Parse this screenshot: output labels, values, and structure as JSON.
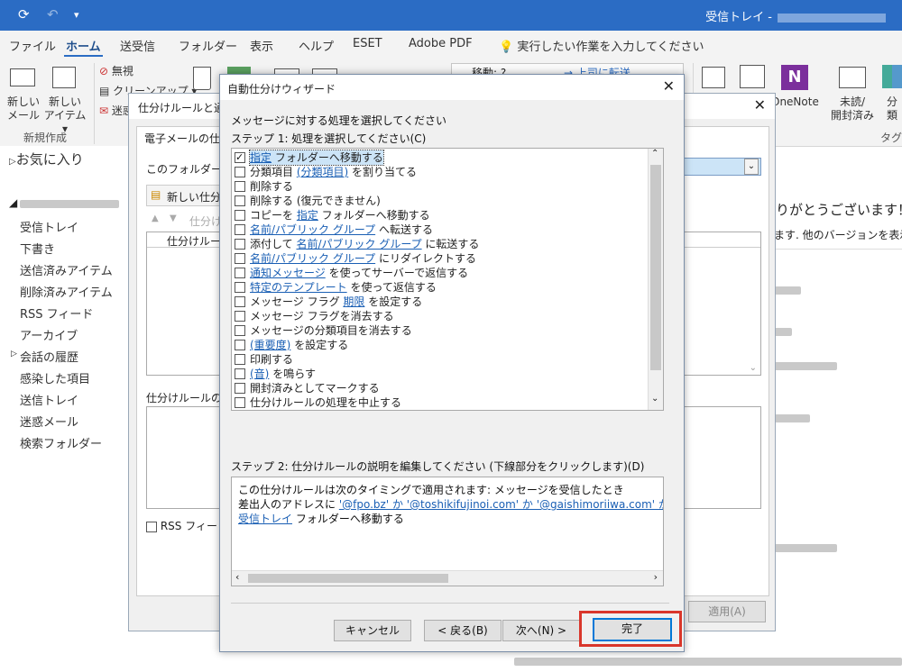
{
  "titlebar": {
    "title": "受信トレイ -"
  },
  "menu": [
    "ファイル",
    "ホーム",
    "送受信",
    "フォルダー",
    "表示",
    "ヘルプ",
    "ESET",
    "Adobe PDF"
  ],
  "tell_me": "実行したい作業を入力してください",
  "ribbon": {
    "new_mail": [
      "新しい",
      "メール"
    ],
    "new_item": [
      "新しい",
      "アイテム ▾"
    ],
    "group_new": "新規作成",
    "ignore": "無視",
    "cleanup": "クリーンアップ ▾",
    "junk": "迷惑",
    "move_to": "移動: ?",
    "forward_to": "上司に転送",
    "onenote": "OneNote",
    "unread": [
      "未読/",
      "開封済み"
    ],
    "categorize": "分類",
    "group_tag": "タグ"
  },
  "nav": {
    "favorites": "お気に入り",
    "folders": [
      "受信トレイ",
      "下書き",
      "送信済みアイテム",
      "削除済みアイテム",
      "RSS フィード",
      "アーカイブ",
      "会話の履歴",
      "感染した項目",
      "送信トレイ",
      "迷惑メール",
      "検索フォルダー"
    ]
  },
  "content": {
    "thanks": "りがとうございます！",
    "other_versions": "ます. 他のバージョンを表示する"
  },
  "rules_dialog": {
    "title": "仕分けルールと通知",
    "tab": "電子メールの仕分",
    "apply_to": "このフォルダーに変",
    "new_rule": "新しい仕分",
    "rule_col": "仕分けルール",
    "desc_label": "仕分けルールの説",
    "rss": "RSS フィードが",
    "apply_button": "適用(A)"
  },
  "wizard": {
    "title": "自動仕分けウィザード",
    "instruction": "メッセージに対する処理を選択してください",
    "step1": "ステップ 1: 処理を選択してください(C)",
    "step2": "ステップ 2: 仕分けルールの説明を編集してください (下線部分をクリックします)(D)",
    "actions": [
      {
        "pre": "",
        "link": "指定",
        "post": " フォルダーへ移動する",
        "checked": true
      },
      {
        "pre": "分類項目 ",
        "link": "(分類項目)",
        "post": " を割り当てる",
        "checked": false
      },
      {
        "pre": "削除する",
        "link": "",
        "post": "",
        "checked": false
      },
      {
        "pre": "削除する (復元できません)",
        "link": "",
        "post": "",
        "checked": false
      },
      {
        "pre": "コピーを ",
        "link": "指定",
        "post": " フォルダーへ移動する",
        "checked": false
      },
      {
        "pre": "",
        "link": "名前/パブリック グループ",
        "post": " へ転送する",
        "checked": false
      },
      {
        "pre": "添付して ",
        "link": "名前/パブリック グループ",
        "post": " に転送する",
        "checked": false
      },
      {
        "pre": "",
        "link": "名前/パブリック グループ",
        "post": " にリダイレクトする",
        "checked": false
      },
      {
        "pre": "",
        "link": "通知メッセージ",
        "post": " を使ってサーバーで返信する",
        "checked": false
      },
      {
        "pre": "",
        "link": "特定のテンプレート",
        "post": " を使って返信する",
        "checked": false
      },
      {
        "pre": "メッセージ フラグ ",
        "link": "期限",
        "post": " を設定する",
        "checked": false
      },
      {
        "pre": "メッセージ フラグを消去する",
        "link": "",
        "post": "",
        "checked": false
      },
      {
        "pre": "メッセージの分類項目を消去する",
        "link": "",
        "post": "",
        "checked": false
      },
      {
        "pre": "",
        "link": "(重要度)",
        "post": " を設定する",
        "checked": false
      },
      {
        "pre": "印刷する",
        "link": "",
        "post": "",
        "checked": false
      },
      {
        "pre": "",
        "link": "(音)",
        "post": " を鳴らす",
        "checked": false
      },
      {
        "pre": "開封済みとしてマークする",
        "link": "",
        "post": "",
        "checked": false
      },
      {
        "pre": "仕分けルールの処理を中止する",
        "link": "",
        "post": "",
        "checked": false
      }
    ],
    "desc_line1": "この仕分けルールは次のタイミングで適用されます: メッセージを受信したとき",
    "desc_line2_pre": "差出人のアドレスに ",
    "desc_line2_link": "'@fpo.bz' か '@toshikifujinoi.com' か '@gaishimoriiwa.com' か '@a",
    "desc_line3_link": "受信トレイ",
    "desc_line3_post": " フォルダーへ移動する",
    "cancel": "キャンセル",
    "back": "< 戻る(B)",
    "next": "次へ(N) >",
    "finish": "完了"
  }
}
